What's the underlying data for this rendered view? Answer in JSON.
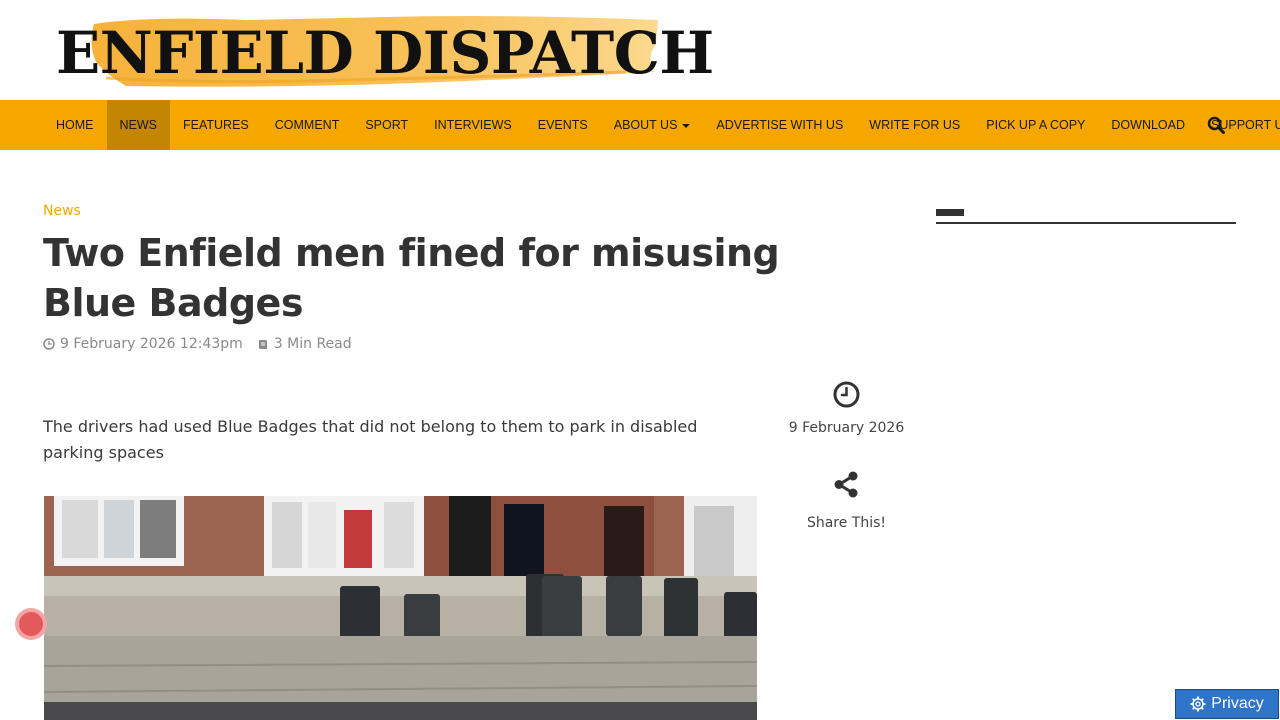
{
  "brand": {
    "name": "ENFIELD DISPATCH"
  },
  "nav": {
    "items": [
      {
        "label": "HOME"
      },
      {
        "label": "NEWS"
      },
      {
        "label": "FEATURES"
      },
      {
        "label": "COMMENT"
      },
      {
        "label": "SPORT"
      },
      {
        "label": "INTERVIEWS"
      },
      {
        "label": "EVENTS"
      },
      {
        "label": "ABOUT US"
      },
      {
        "label": "ADVERTISE WITH US"
      },
      {
        "label": "WRITE FOR US"
      },
      {
        "label": "PICK UP A COPY"
      },
      {
        "label": "DOWNLOAD"
      },
      {
        "label": "SUPPORT US"
      }
    ],
    "active": "NEWS",
    "search_icon": "search-icon"
  },
  "article": {
    "category": "News",
    "title": "Two Enfield men fined for misusing Blue Badges",
    "date": "9 February 2026 12:43pm",
    "read_time": "3 Min Read",
    "lead": "The drivers had used Blue Badges that did not belong to them to park in disabled parking spaces"
  },
  "side": {
    "date": "9 February 2026",
    "share_label": "Share This!"
  },
  "privacy": {
    "label": "Privacy"
  },
  "colors": {
    "accent": "#f5a700",
    "nav_active": "#c48600",
    "privacy_button": "#2e74c8"
  }
}
